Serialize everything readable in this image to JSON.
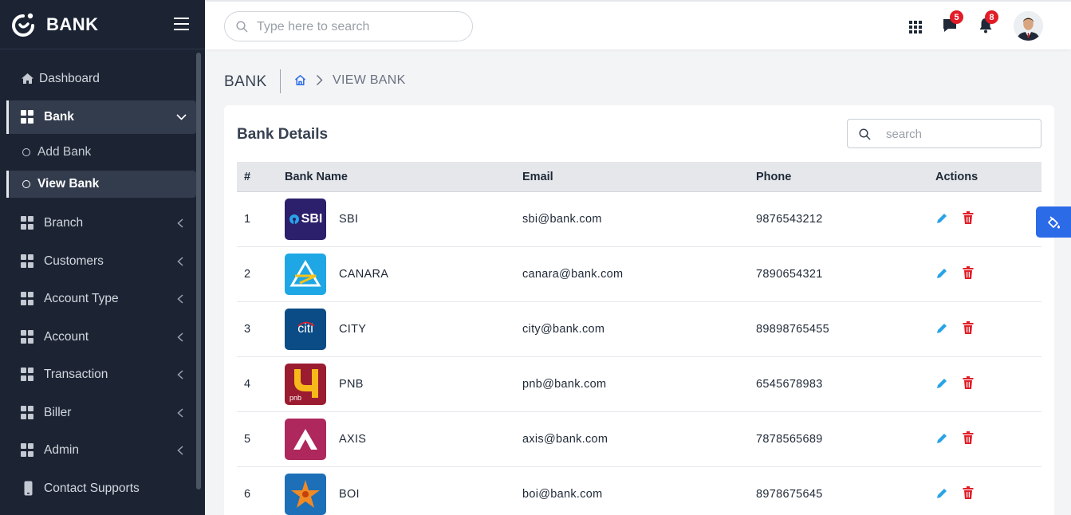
{
  "brand": {
    "name": "BANK"
  },
  "sidebar": {
    "items": [
      {
        "label": "Dashboard",
        "icon": "home-icon"
      },
      {
        "label": "Bank",
        "icon": "grid-icon",
        "expanded": true,
        "children": [
          {
            "label": "Add Bank"
          },
          {
            "label": "View Bank",
            "active": true
          }
        ]
      },
      {
        "label": "Branch",
        "icon": "grid-icon"
      },
      {
        "label": "Customers",
        "icon": "grid-icon"
      },
      {
        "label": "Account Type",
        "icon": "grid-icon"
      },
      {
        "label": "Account",
        "icon": "grid-icon"
      },
      {
        "label": "Transaction",
        "icon": "grid-icon"
      },
      {
        "label": "Biller",
        "icon": "grid-icon"
      },
      {
        "label": "Admin",
        "icon": "grid-icon"
      },
      {
        "label": "Contact Supports",
        "icon": "phone-icon"
      }
    ]
  },
  "topbar": {
    "search_placeholder": "Type here to search",
    "messages_count": "5",
    "notifications_count": "8"
  },
  "breadcrumb": {
    "page_title": "BANK",
    "current": "VIEW BANK"
  },
  "card": {
    "title": "Bank Details",
    "search_placeholder": "search",
    "columns": [
      "#",
      "Bank Name",
      "Email",
      "Phone",
      "Actions"
    ],
    "rows": [
      {
        "no": "1",
        "name": "SBI",
        "email": "sbi@bank.com",
        "phone": "9876543212",
        "logo_text": "SBI"
      },
      {
        "no": "2",
        "name": "CANARA",
        "email": "canara@bank.com",
        "phone": "7890654321",
        "logo_text": ""
      },
      {
        "no": "3",
        "name": "CITY",
        "email": "city@bank.com",
        "phone": "89898765455",
        "logo_text": "citi"
      },
      {
        "no": "4",
        "name": "PNB",
        "email": "pnb@bank.com",
        "phone": "6545678983",
        "logo_text": "pnb"
      },
      {
        "no": "5",
        "name": "AXIS",
        "email": "axis@bank.com",
        "phone": "7878565689",
        "logo_text": ""
      },
      {
        "no": "6",
        "name": "BOI",
        "email": "boi@bank.com",
        "phone": "8978675645",
        "logo_text": ""
      }
    ]
  },
  "colors": {
    "sidebar_bg": "#1c2434",
    "accent_blue": "#2c6be8",
    "edit_icon": "#29a3e8",
    "delete_icon": "#e11d27",
    "badge": "#e11d27"
  }
}
